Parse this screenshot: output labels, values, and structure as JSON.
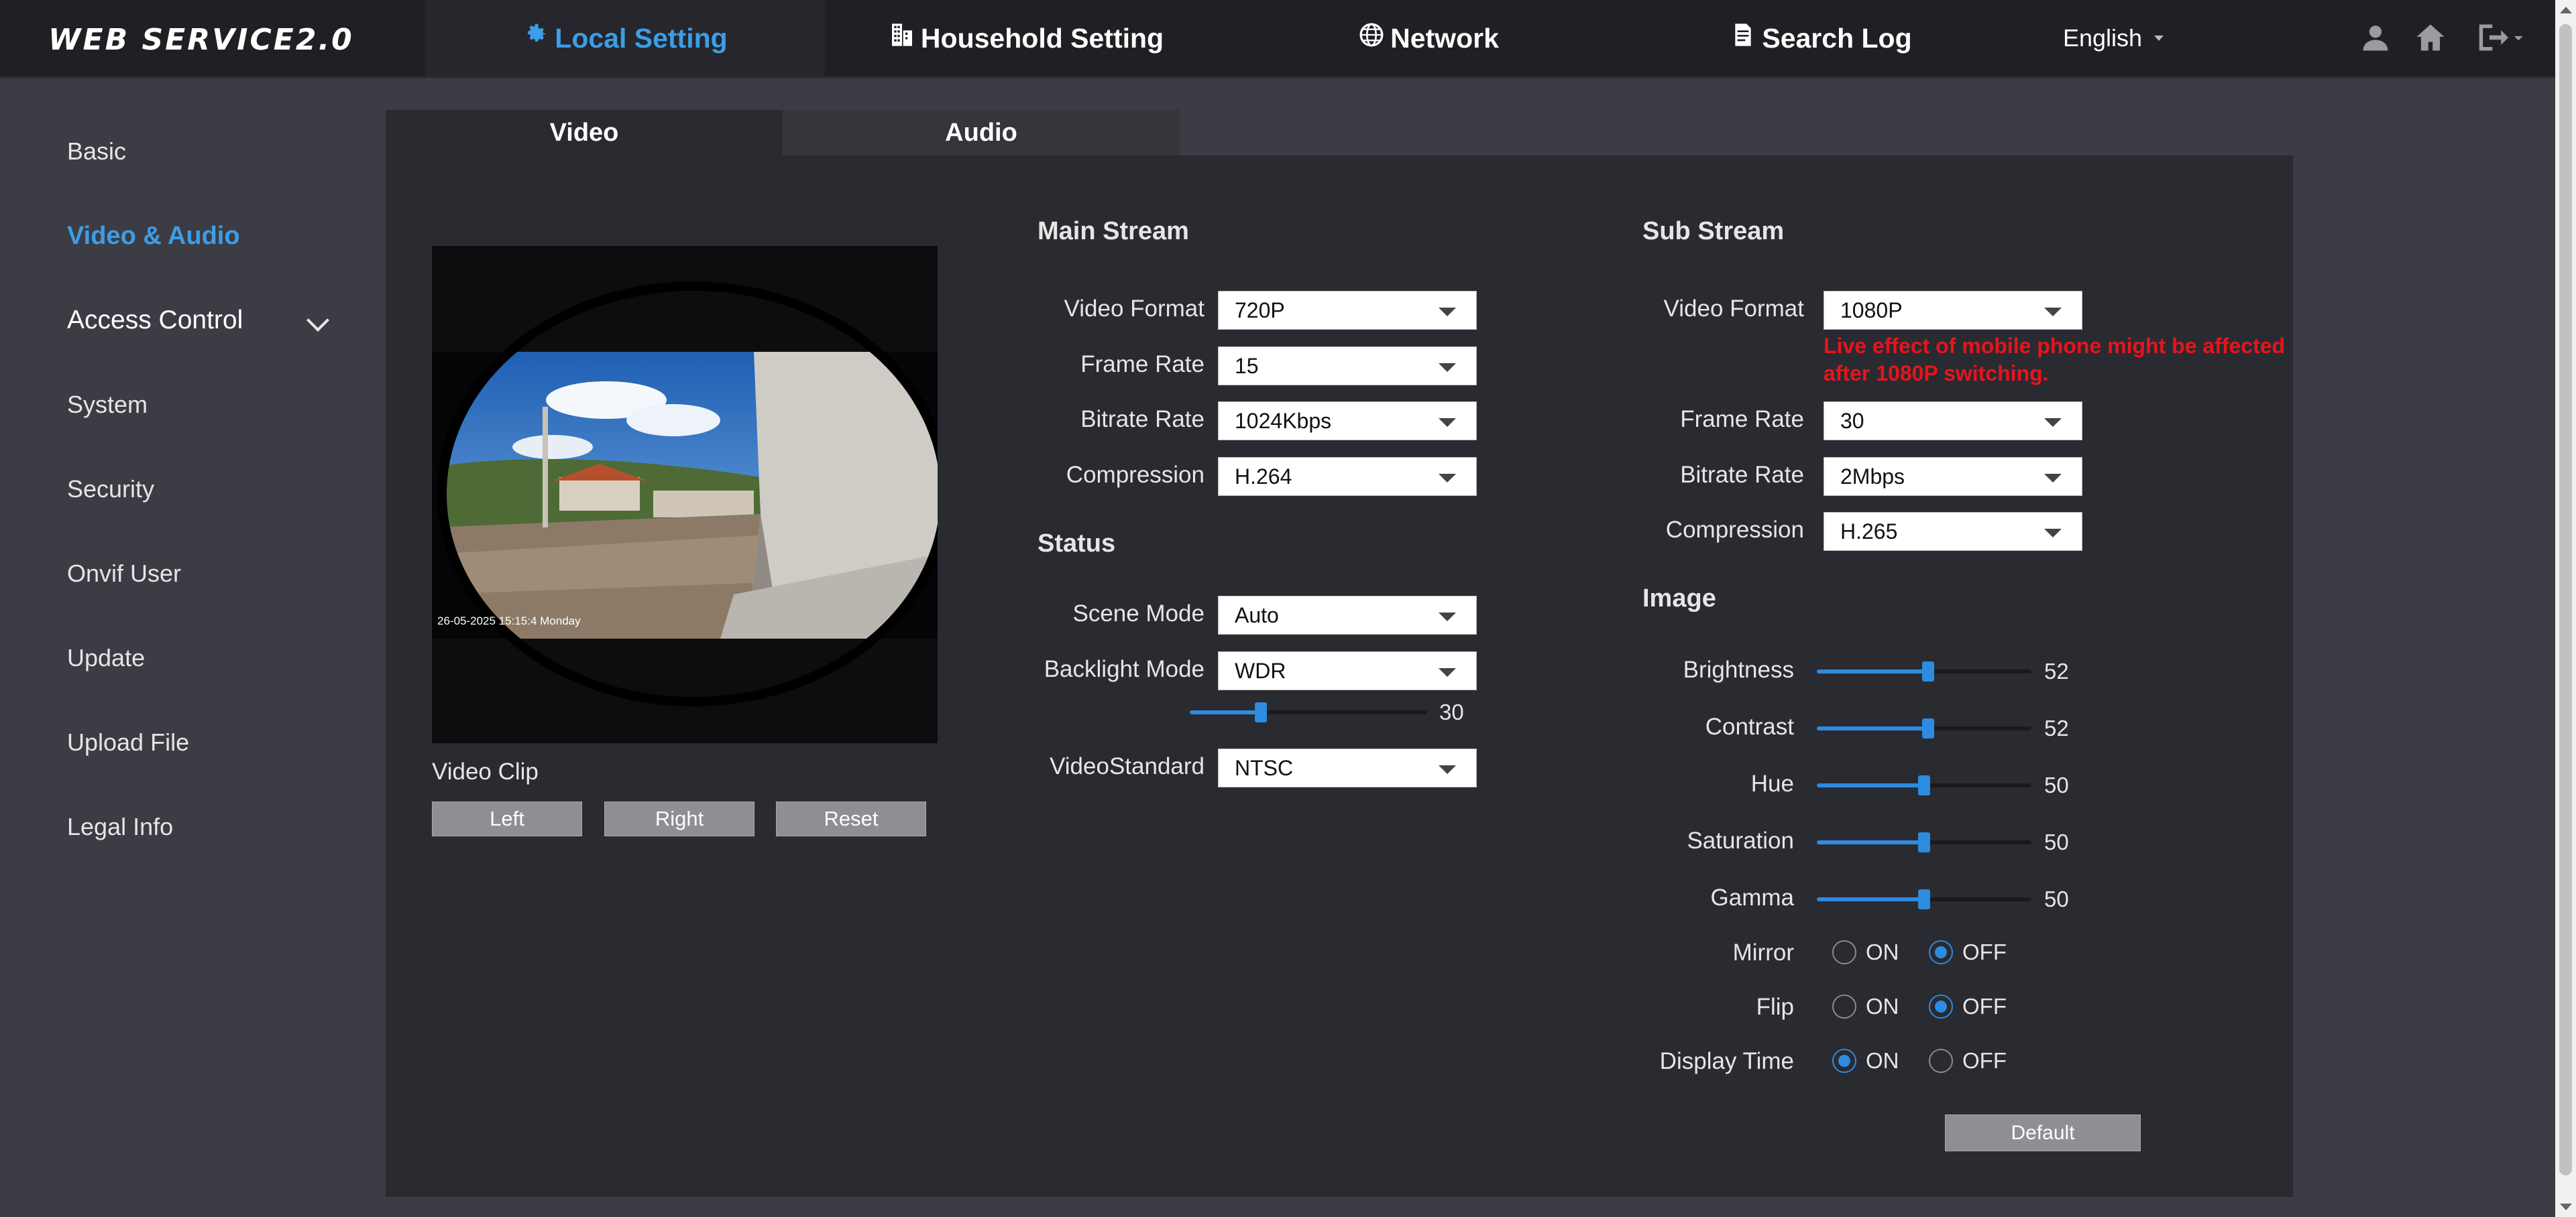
{
  "header": {
    "logo": "WEB SERVICE2.0",
    "nav": [
      {
        "label": "Local Setting",
        "icon": "gear-icon",
        "active": true
      },
      {
        "label": "Household Setting",
        "icon": "building-icon"
      },
      {
        "label": "Network",
        "icon": "globe-icon"
      },
      {
        "label": "Search Log",
        "icon": "document-icon"
      }
    ],
    "language": "English",
    "icons": [
      "user-icon",
      "home-icon",
      "logout-icon"
    ]
  },
  "sidebar": {
    "items": [
      {
        "label": "Basic"
      },
      {
        "label": "Video & Audio",
        "active": true
      },
      {
        "label": "Access Control",
        "expandable": true
      },
      {
        "label": "System"
      },
      {
        "label": "Security"
      },
      {
        "label": "Onvif User"
      },
      {
        "label": "Update"
      },
      {
        "label": "Upload File"
      },
      {
        "label": "Legal Info"
      }
    ]
  },
  "tabs": [
    {
      "label": "Video",
      "active": true
    },
    {
      "label": "Audio"
    }
  ],
  "preview": {
    "timestamp": "26-05-2025 15:15:4 Monday",
    "clip_label": "Video Clip",
    "buttons": [
      "Left",
      "Right",
      "Reset"
    ]
  },
  "main_stream": {
    "title": "Main Stream",
    "fields": [
      {
        "label": "Video Format",
        "value": "720P"
      },
      {
        "label": "Frame Rate",
        "value": "15"
      },
      {
        "label": "Bitrate Rate",
        "value": "1024Kbps"
      },
      {
        "label": "Compression",
        "value": "H.264"
      }
    ]
  },
  "status": {
    "title": "Status",
    "scene_mode": {
      "label": "Scene Mode",
      "value": "Auto"
    },
    "backlight_mode": {
      "label": "Backlight Mode",
      "value": "WDR"
    },
    "backlight_level": {
      "value": 30,
      "min": 0,
      "max": 100
    },
    "video_standard": {
      "label": "VideoStandard",
      "value": "NTSC"
    }
  },
  "sub_stream": {
    "title": "Sub Stream",
    "fields": [
      {
        "label": "Video Format",
        "value": "1080P"
      },
      {
        "label": "Frame Rate",
        "value": "30"
      },
      {
        "label": "Bitrate Rate",
        "value": "2Mbps"
      },
      {
        "label": "Compression",
        "value": "H.265"
      }
    ],
    "warning": "Live effect of mobile phone might be affected after 1080P switching."
  },
  "image": {
    "title": "Image",
    "sliders": [
      {
        "label": "Brightness",
        "value": 52,
        "max": 100
      },
      {
        "label": "Contrast",
        "value": 52,
        "max": 100
      },
      {
        "label": "Hue",
        "value": 50,
        "max": 100
      },
      {
        "label": "Saturation",
        "value": 50,
        "max": 100
      },
      {
        "label": "Gamma",
        "value": 50,
        "max": 100
      }
    ],
    "toggles": [
      {
        "label": "Mirror",
        "on_label": "ON",
        "off_label": "OFF",
        "value": "OFF"
      },
      {
        "label": "Flip",
        "on_label": "ON",
        "off_label": "OFF",
        "value": "OFF"
      },
      {
        "label": "Display Time",
        "on_label": "ON",
        "off_label": "OFF",
        "value": "ON"
      }
    ],
    "default_button": "Default"
  },
  "colors": {
    "accent": "#3b9ee6",
    "slider": "#2d8be0",
    "warning": "#e8141c",
    "panel": "#2a2a31",
    "page": "#3c3c44",
    "topbar": "#1f1f24"
  }
}
